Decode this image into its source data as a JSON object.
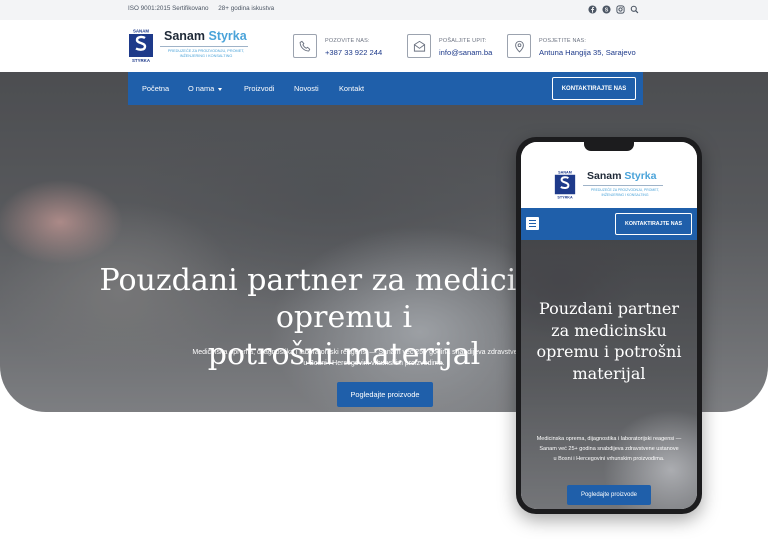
{
  "topbar": {
    "certificate": "ISO 9001:2015 Sertifikovano",
    "experience": "28+ godina iskustva",
    "social_icons": [
      "facebook-icon",
      "skype-icon",
      "instagram-icon",
      "search-icon"
    ]
  },
  "brand": {
    "name_dark": "Sanam",
    "name_light": "Styrka",
    "tagline": "PREDUZEĆE ZA PROIZVODNJU, PROMET, INŽENJERING I KONSALTING",
    "logo_top": "SANAM",
    "logo_bottom": "STYRKA"
  },
  "contacts": [
    {
      "icon": "phone-icon",
      "label": "POZOVITE NAS:",
      "value": "+387 33 922 244"
    },
    {
      "icon": "mail-icon",
      "label": "POŠALJITE UPIT:",
      "value": "info@sanam.ba"
    },
    {
      "icon": "location-icon",
      "label": "POSJETITE NAS:",
      "value": "Antuna Hangija 35, Sarajevo"
    }
  ],
  "nav": {
    "items": [
      "Početna",
      "O nama",
      "Proizvodi",
      "Novosti",
      "Kontakt"
    ],
    "cta": "KONTAKTIRAJTE NAS"
  },
  "hero": {
    "title_line1": "Pouzdani partner za medicinsku opremu i",
    "title_line2": "potrošni materijal",
    "subtitle_line1": "Medicinska oprema, dijagnostika i laboratorijski reagensi — Sanam već 25+ godina snabdijeva zdravstvene ustanove",
    "subtitle_line2": "u Bosni i Hercegovini vrhunskim proizvodima.",
    "button": "Pogledajte proizvode"
  },
  "mobile": {
    "title": "Pouzdani partner za medicinsku opremu i potrošni materijal",
    "subtitle_line1": "Medicinska oprema, dijagnostika i laboratorijski reagensi — Sanam već 25+ godina snabdijeva zdravstvene ustanove",
    "subtitle_line2": "u Bosni i Hercegovini vrhunskim proizvodima.",
    "button": "Pogledajte proizvode",
    "cta": "KONTAKTIRAJTE NAS"
  },
  "colors": {
    "primary": "#1f5faa",
    "accent": "#4aa3d9",
    "topbar_bg": "#f3f4f6"
  }
}
